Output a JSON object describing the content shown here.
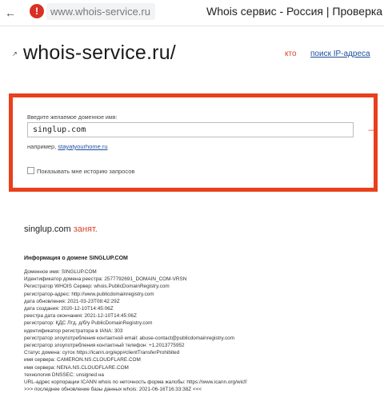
{
  "browser": {
    "nav_arrow": "←",
    "warning_icon": "!",
    "url": "www.whois-service.ru",
    "tab_title": "Whois сервис - Россия | Проверка д"
  },
  "header": {
    "logo_icon": "↗",
    "logo": "whois-service.ru/",
    "nav_who": "кто",
    "nav_ip": "поиск IP-адреса"
  },
  "search": {
    "label": "Введите желаемое доменное имя:",
    "input_value": "singlup.com",
    "submit_arrow": "→",
    "example_prefix": "например,",
    "example_link": "stayatyourhome.ru",
    "history_label": "Показывать мне историю запросов",
    "accent_color": "#e8401c"
  },
  "result": {
    "domain": "singlup.com",
    "status": "занят.",
    "info_heading": "Информация о домене SINGLUP.COM",
    "lines": [
      "Доменное имя: SINGLUP.COM",
      "Идентификатор домена реестра: 2577792691_DOMAIN_COM-VRSN",
      "Регистратор WHOIS Сервер: whois.PublicDomainRegistry.com",
      "регистратор-адрес: http://www.publicdomainregistry.com",
      "дата обновления: 2021-03-23T08:42:29Z",
      "дата создания: 2020-12-10T14:45:06Z",
      "реестра дата окончания: 2021-12-10T14:45:06Z",
      "регистратор: ҚДС Лтд. д/б/у PublicDomainRegistry.com",
      "идентификатор регистратора в IANA: 303",
      "регистратор злоупотребления контактной email: abuse-contact@publicdomainregistry.com",
      "регистратор злоупотребления контактный телефон: +1.2013775952",
      "Статус домена: сутох https://icann.org/epp#clientTransferProhibited",
      "имя сервера: CAMERON.NS.CLOUDFLARE.COM",
      "имя сервера: NENA.NS.CLOUDFLARE.COM",
      "технология DNSSEC: unsigned на",
      "URL-адрес корпорации ICANN whois по неточность форма жалобы: https://www.icann.org/wicf/",
      ">>> последнее обновление базы данных whois: 2021-06-16T16:33:38Z <<<"
    ]
  }
}
